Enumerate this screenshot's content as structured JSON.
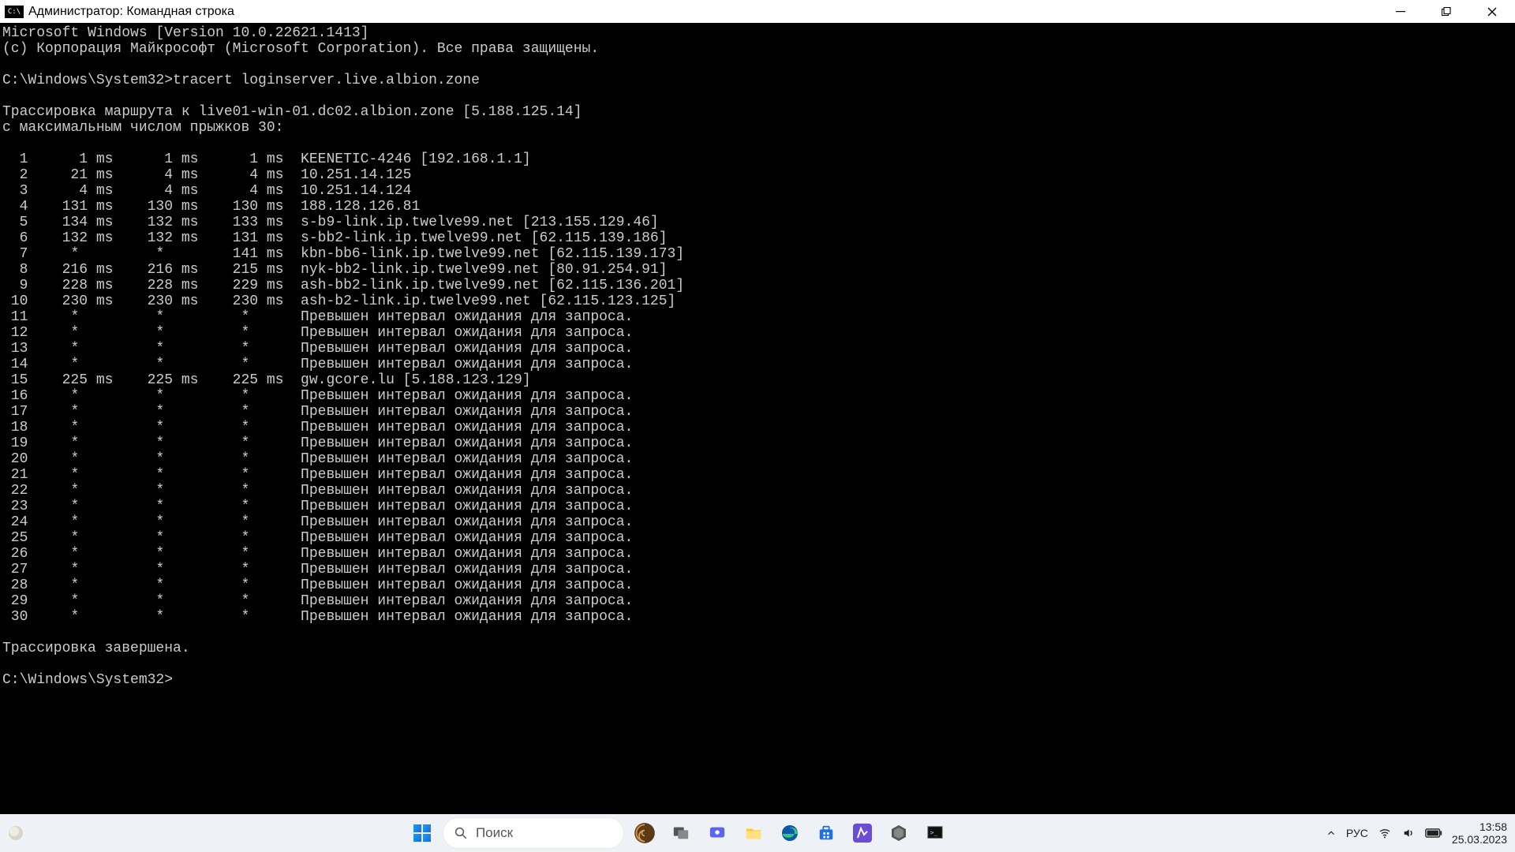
{
  "titlebar": {
    "icon_text": "C:\\",
    "title": "Администратор: Командная строка"
  },
  "terminal": {
    "line_version": "Microsoft Windows [Version 10.0.22621.1413]",
    "line_copyright": "(c) Корпорация Майкрософт (Microsoft Corporation). Все права защищены.",
    "prompt1_path": "C:\\Windows\\System32>",
    "prompt1_cmd": "tracert loginserver.live.albion.zone",
    "trace_header1": "Трассировка маршрута к live01-win-01.dc02.albion.zone [5.188.125.14]",
    "trace_header2": "с максимальным числом прыжков 30:",
    "hops": [
      {
        "n": 1,
        "t1": "1 ms",
        "t2": "1 ms",
        "t3": "1 ms",
        "host": "KEENETIC-4246 [192.168.1.1]"
      },
      {
        "n": 2,
        "t1": "21 ms",
        "t2": "4 ms",
        "t3": "4 ms",
        "host": "10.251.14.125"
      },
      {
        "n": 3,
        "t1": "4 ms",
        "t2": "4 ms",
        "t3": "4 ms",
        "host": "10.251.14.124"
      },
      {
        "n": 4,
        "t1": "131 ms",
        "t2": "130 ms",
        "t3": "130 ms",
        "host": "188.128.126.81"
      },
      {
        "n": 5,
        "t1": "134 ms",
        "t2": "132 ms",
        "t3": "133 ms",
        "host": "s-b9-link.ip.twelve99.net [213.155.129.46]"
      },
      {
        "n": 6,
        "t1": "132 ms",
        "t2": "132 ms",
        "t3": "131 ms",
        "host": "s-bb2-link.ip.twelve99.net [62.115.139.186]"
      },
      {
        "n": 7,
        "t1": "*",
        "t2": "*",
        "t3": "141 ms",
        "host": "kbn-bb6-link.ip.twelve99.net [62.115.139.173]"
      },
      {
        "n": 8,
        "t1": "216 ms",
        "t2": "216 ms",
        "t3": "215 ms",
        "host": "nyk-bb2-link.ip.twelve99.net [80.91.254.91]"
      },
      {
        "n": 9,
        "t1": "228 ms",
        "t2": "228 ms",
        "t3": "229 ms",
        "host": "ash-bb2-link.ip.twelve99.net [62.115.136.201]"
      },
      {
        "n": 10,
        "t1": "230 ms",
        "t2": "230 ms",
        "t3": "230 ms",
        "host": "ash-b2-link.ip.twelve99.net [62.115.123.125]"
      },
      {
        "n": 11,
        "t1": "*",
        "t2": "*",
        "t3": "*",
        "host": "Превышен интервал ожидания для запроса."
      },
      {
        "n": 12,
        "t1": "*",
        "t2": "*",
        "t3": "*",
        "host": "Превышен интервал ожидания для запроса."
      },
      {
        "n": 13,
        "t1": "*",
        "t2": "*",
        "t3": "*",
        "host": "Превышен интервал ожидания для запроса."
      },
      {
        "n": 14,
        "t1": "*",
        "t2": "*",
        "t3": "*",
        "host": "Превышен интервал ожидания для запроса."
      },
      {
        "n": 15,
        "t1": "225 ms",
        "t2": "225 ms",
        "t3": "225 ms",
        "host": "gw.gcore.lu [5.188.123.129]"
      },
      {
        "n": 16,
        "t1": "*",
        "t2": "*",
        "t3": "*",
        "host": "Превышен интервал ожидания для запроса."
      },
      {
        "n": 17,
        "t1": "*",
        "t2": "*",
        "t3": "*",
        "host": "Превышен интервал ожидания для запроса."
      },
      {
        "n": 18,
        "t1": "*",
        "t2": "*",
        "t3": "*",
        "host": "Превышен интервал ожидания для запроса."
      },
      {
        "n": 19,
        "t1": "*",
        "t2": "*",
        "t3": "*",
        "host": "Превышен интервал ожидания для запроса."
      },
      {
        "n": 20,
        "t1": "*",
        "t2": "*",
        "t3": "*",
        "host": "Превышен интервал ожидания для запроса."
      },
      {
        "n": 21,
        "t1": "*",
        "t2": "*",
        "t3": "*",
        "host": "Превышен интервал ожидания для запроса."
      },
      {
        "n": 22,
        "t1": "*",
        "t2": "*",
        "t3": "*",
        "host": "Превышен интервал ожидания для запроса."
      },
      {
        "n": 23,
        "t1": "*",
        "t2": "*",
        "t3": "*",
        "host": "Превышен интервал ожидания для запроса."
      },
      {
        "n": 24,
        "t1": "*",
        "t2": "*",
        "t3": "*",
        "host": "Превышен интервал ожидания для запроса."
      },
      {
        "n": 25,
        "t1": "*",
        "t2": "*",
        "t3": "*",
        "host": "Превышен интервал ожидания для запроса."
      },
      {
        "n": 26,
        "t1": "*",
        "t2": "*",
        "t3": "*",
        "host": "Превышен интервал ожидания для запроса."
      },
      {
        "n": 27,
        "t1": "*",
        "t2": "*",
        "t3": "*",
        "host": "Превышен интервал ожидания для запроса."
      },
      {
        "n": 28,
        "t1": "*",
        "t2": "*",
        "t3": "*",
        "host": "Превышен интервал ожидания для запроса."
      },
      {
        "n": 29,
        "t1": "*",
        "t2": "*",
        "t3": "*",
        "host": "Превышен интервал ожидания для запроса."
      },
      {
        "n": 30,
        "t1": "*",
        "t2": "*",
        "t3": "*",
        "host": "Превышен интервал ожидания для запроса."
      }
    ],
    "trace_done": "Трассировка завершена.",
    "prompt2_path": "C:\\Windows\\System32>"
  },
  "taskbar": {
    "search_placeholder": "Поиск"
  },
  "tray": {
    "lang": "РУС",
    "time": "13:58",
    "date": "25.03.2023"
  }
}
